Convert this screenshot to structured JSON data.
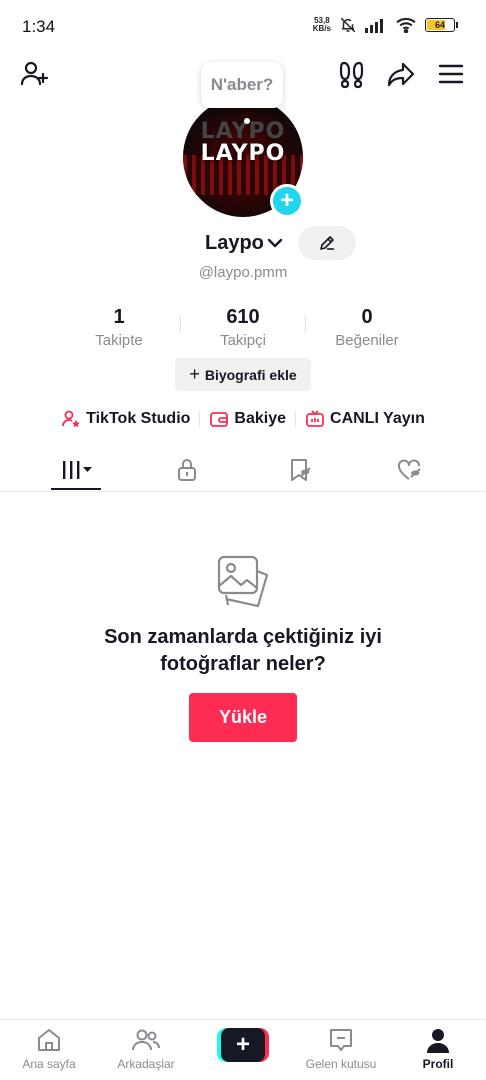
{
  "status_bar": {
    "time": "1:34",
    "net_speed_value": "53,8",
    "net_speed_unit": "KB/s",
    "battery_level": "64"
  },
  "profile": {
    "bubble_text": "N'aber?",
    "avatar_text": "LAYPO",
    "name": "Laypo",
    "handle": "@laypo.pmm",
    "stats": [
      {
        "value": "1",
        "label": "Takipte"
      },
      {
        "value": "610",
        "label": "Takipçi"
      },
      {
        "value": "0",
        "label": "Beğeniler"
      }
    ],
    "bio_button": "Biyografi ekle"
  },
  "links": [
    {
      "label": "TikTok Studio",
      "icon": "studio-person-star-icon"
    },
    {
      "label": "Bakiye",
      "icon": "wallet-icon"
    },
    {
      "label": "CANLI Yayın",
      "icon": "live-tv-icon"
    }
  ],
  "tabs": [
    {
      "icon": "videos-grid-icon",
      "active": true
    },
    {
      "icon": "lock-icon"
    },
    {
      "icon": "bookmark-icon"
    },
    {
      "icon": "liked-heart-icon"
    }
  ],
  "empty_state": {
    "line1": "Son zamanlarda çektiğiniz iyi",
    "line2": "fotoğraflar neler?",
    "button": "Yükle"
  },
  "bottom_nav": [
    {
      "label": "Ana sayfa",
      "icon": "home-icon"
    },
    {
      "label": "Arkadaşlar",
      "icon": "friends-icon"
    },
    {
      "label": "",
      "icon": "create-plus-icon"
    },
    {
      "label": "Gelen kutusu",
      "icon": "inbox-icon"
    },
    {
      "label": "Profil",
      "icon": "profile-icon",
      "active": true
    }
  ],
  "colors": {
    "accent": "#fe2c55",
    "cyan": "#25f4ee",
    "text_primary": "#161823",
    "text_secondary": "#8a8b91"
  }
}
